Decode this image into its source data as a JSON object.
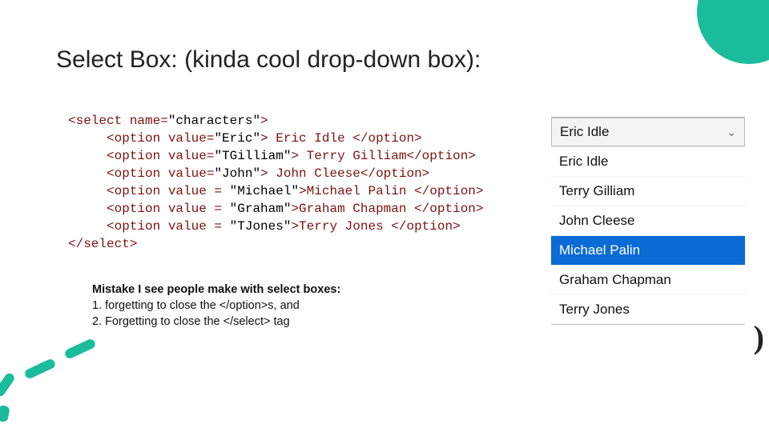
{
  "title": "Select Box: (kinda cool drop-down box):",
  "code": {
    "l1a": "<select name=",
    "l1b": "\"characters\"",
    "l1c": ">",
    "l2a": "     <option value=",
    "l2b": "\"Eric\"",
    "l2c": "> Eric Idle </option>",
    "l3a": "     <option value=",
    "l3b": "\"TGilliam\"",
    "l3c": "> Terry Gilliam</option>",
    "l4a": "     <option value=",
    "l4b": "\"John\"",
    "l4c": "> John Cleese</option>",
    "l5a": "     <option value = ",
    "l5b": "\"Michael\"",
    "l5c": ">Michael Palin </option>",
    "l6a": "     <option value = ",
    "l6b": "\"Graham\"",
    "l6c": ">Graham Chapman </option>",
    "l7a": "     <option value = ",
    "l7b": "\"TJones\"",
    "l7c": ">Terry Jones </option>",
    "l8": "</select>"
  },
  "mistakes": {
    "header": "Mistake I see people make with select boxes:",
    "item1": " 1.  forgetting to close the </option>s,  and",
    "item2": " 2.  Forgetting to close the </select> tag"
  },
  "dropdown": {
    "selected": "Eric Idle",
    "options": [
      "Eric Idle",
      "Terry Gilliam",
      "John Cleese",
      "Michael Palin",
      "Graham Chapman",
      "Terry Jones"
    ],
    "highlighted_index": 3
  },
  "partial_char": ")"
}
